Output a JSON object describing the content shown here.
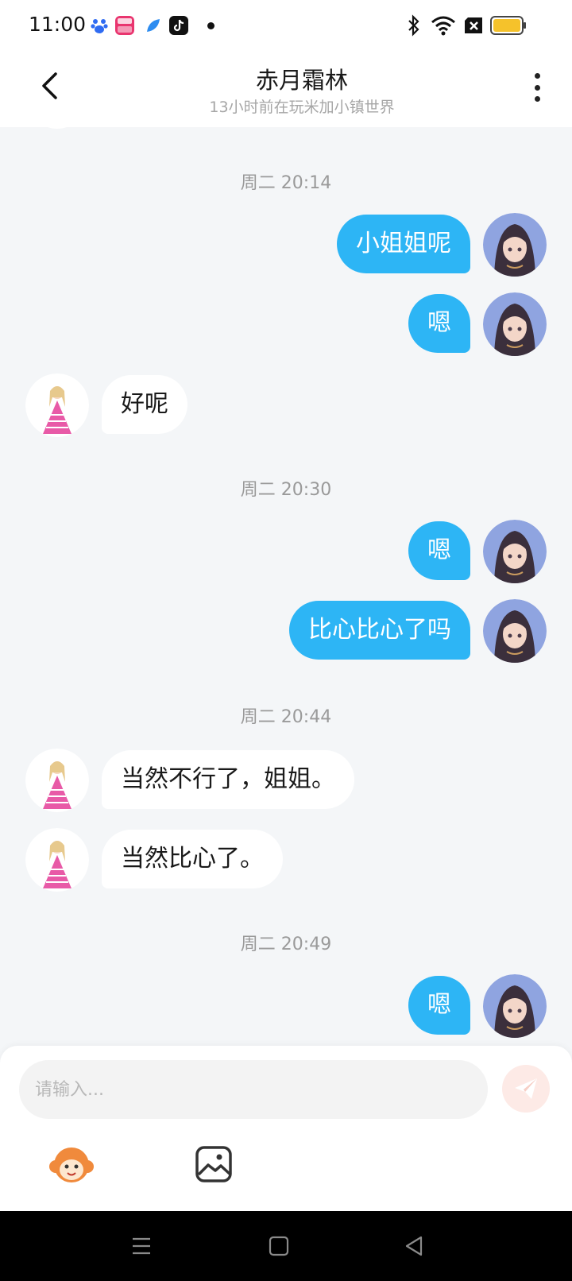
{
  "status_bar": {
    "time": "11:00",
    "icons": [
      "baidu-app-icon",
      "news-app-icon",
      "feather-app-icon",
      "tiktok-app-icon",
      "notification-dot",
      "bluetooth-icon",
      "wifi-icon",
      "no-sim-icon",
      "battery-icon"
    ]
  },
  "header": {
    "title": "赤月霜林",
    "subtitle": "13小时前在玩米加小镇世界",
    "back_icon": "chevron-left-icon",
    "more_icon": "more-vertical-icon"
  },
  "messages": [
    {
      "type": "time",
      "text": "周二 20:14"
    },
    {
      "type": "msg",
      "from": "self",
      "text": "小姐姐呢"
    },
    {
      "type": "msg",
      "from": "self",
      "text": "嗯"
    },
    {
      "type": "msg",
      "from": "other",
      "text": "好呢"
    },
    {
      "type": "time",
      "text": "周二 20:30"
    },
    {
      "type": "msg",
      "from": "self",
      "text": "嗯"
    },
    {
      "type": "msg",
      "from": "self",
      "text": "比心比心了吗"
    },
    {
      "type": "time",
      "text": "周二 20:44"
    },
    {
      "type": "msg",
      "from": "other",
      "text": "当然不行了，姐姐。"
    },
    {
      "type": "msg",
      "from": "other",
      "text": "当然比心了。"
    },
    {
      "type": "time",
      "text": "周二 20:49"
    },
    {
      "type": "msg",
      "from": "self",
      "text": "嗯"
    }
  ],
  "input": {
    "placeholder": "请输入...",
    "value": ""
  },
  "toolbar": {
    "send_icon": "send-plane-icon",
    "emoji_icon": "monkey-emoji-icon",
    "image_icon": "image-icon"
  },
  "nav_bar": {
    "icons": [
      "menu-icon",
      "home-square-icon",
      "back-triangle-icon"
    ]
  },
  "colors": {
    "outgoing_bubble": "#2db5f5",
    "incoming_bubble": "#ffffff",
    "chat_background": "#f4f6f8",
    "send_button": "#fdeae6"
  }
}
